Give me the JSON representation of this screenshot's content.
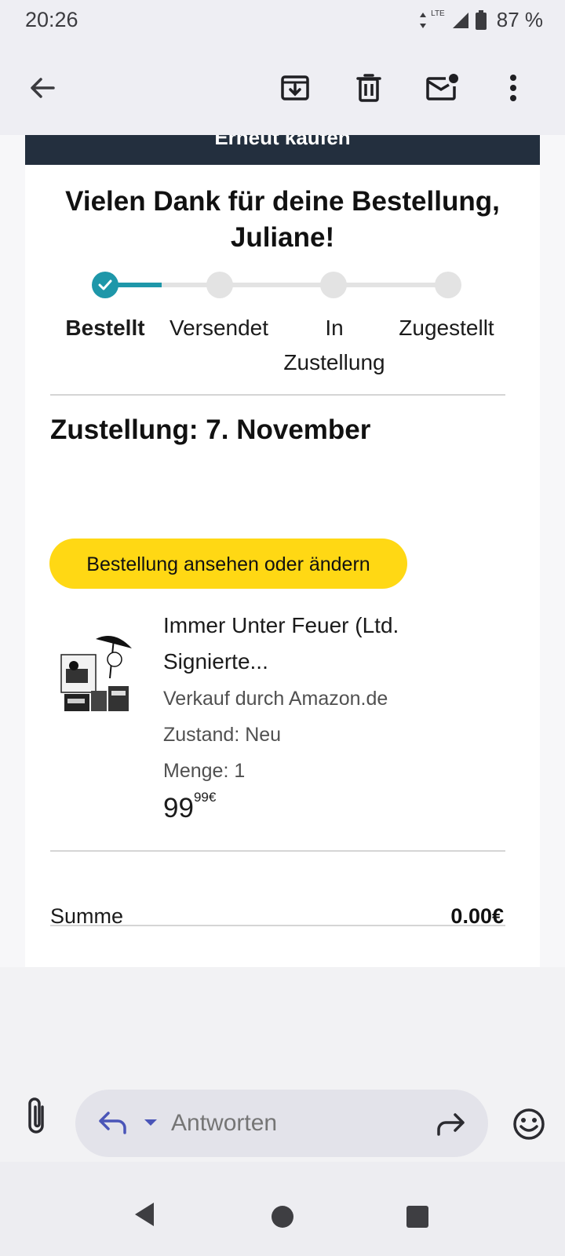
{
  "status_bar": {
    "time": "20:26",
    "network": "LTE",
    "battery_percent": "87 %"
  },
  "app_bar": {
    "icons": [
      "back-arrow-icon",
      "archive-icon",
      "delete-icon",
      "mark-unread-icon",
      "more-vert-icon"
    ]
  },
  "email": {
    "banner_text": "Erneut kaufen",
    "title": "Vielen Dank für deine Bestellung, Juliane!",
    "tracker": {
      "steps": [
        {
          "label": "Bestellt",
          "status": "done"
        },
        {
          "label": "Versendet",
          "status": "pending"
        },
        {
          "label": "In Zustellung",
          "status": "pending"
        },
        {
          "label": "Zugestellt",
          "status": "pending"
        }
      ],
      "accent_color": "#1e97a9"
    },
    "delivery_heading": "Zustellung: 7. November",
    "order_button_label": "Bestellung ansehen oder ändern",
    "order_button_color": "#ffd814",
    "product": {
      "title": "Immer Unter Feuer (Ltd. Signierte...",
      "seller": "Verkauf durch Amazon.de",
      "condition": "Zustand: Neu",
      "quantity": "Menge: 1",
      "price_main": "99",
      "price_fraction": "99€"
    },
    "summary": {
      "label": "Summe",
      "value": "0.00€"
    }
  },
  "reply_bar": {
    "placeholder": "Antworten",
    "icons": [
      "attachment-icon",
      "reply-icon",
      "dropdown-caret-icon",
      "forward-icon",
      "emoji-icon"
    ]
  },
  "nav_bar": {
    "icons": [
      "nav-back-icon",
      "nav-home-icon",
      "nav-recents-icon"
    ]
  }
}
